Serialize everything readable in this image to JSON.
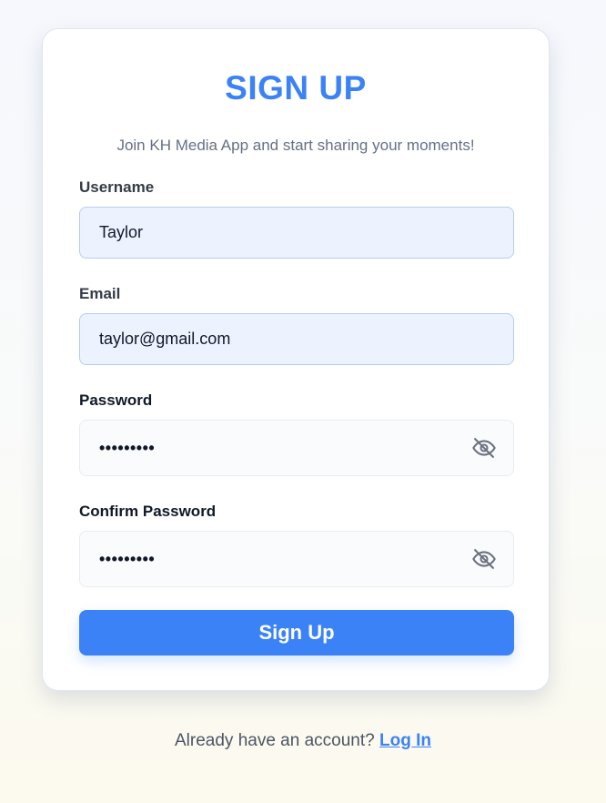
{
  "header": {
    "title": "SIGN UP",
    "subtitle": "Join KH Media App and start sharing your moments!"
  },
  "form": {
    "username": {
      "label": "Username",
      "value": "Taylor"
    },
    "email": {
      "label": "Email",
      "value": "taylor@gmail.com"
    },
    "password": {
      "label": "Password",
      "masked_value": "•••••••••",
      "toggle_icon": "eye-off-icon"
    },
    "confirm_password": {
      "label": "Confirm Password",
      "masked_value": "•••••••••",
      "toggle_icon": "eye-off-icon"
    },
    "submit_label": "Sign Up"
  },
  "footer": {
    "prompt": "Already have an account?",
    "login_link": "Log In"
  },
  "colors": {
    "accent": "#3b82f6",
    "filled_field_bg": "#edf3fe",
    "password_field_bg": "#fafbfd"
  }
}
